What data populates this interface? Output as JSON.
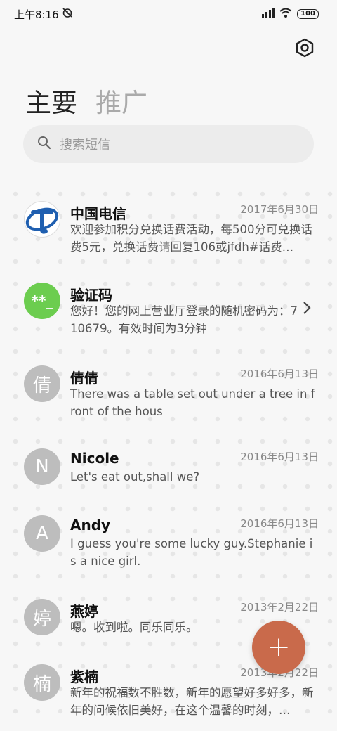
{
  "status_bar": {
    "time": "上午8:16",
    "battery": "100"
  },
  "tabs": [
    {
      "label": "主要"
    },
    {
      "label": "推广"
    }
  ],
  "search": {
    "placeholder": "搜索短信"
  },
  "messages": [
    {
      "name": "中国电信",
      "date": "2017年6月30日",
      "body": "欢迎参加积分兑换话费活动，每500分可兑换话费5元，兑换话费请回复106或jfdh#话费…",
      "avatar": "telecom-logo"
    },
    {
      "name": "验证码",
      "date": "",
      "body": "您好！您的网上营业厅登录的随机密码为：710679。有效时间为3分钟",
      "avatar_text": "**_"
    },
    {
      "name": "倩倩",
      "date": "2016年6月13日",
      "body": "There was a table set out under a tree in front of the hous",
      "avatar_text": "倩"
    },
    {
      "name": "Nicole",
      "date": "2016年6月13日",
      "body": "Let's eat out,shall we?",
      "avatar_text": "N"
    },
    {
      "name": "Andy",
      "date": "2016年6月13日",
      "body": "I guess you're some lucky guy.Stephanie is a nice girl.",
      "avatar_text": "A"
    },
    {
      "name": "燕婷",
      "date": "2013年2月22日",
      "body": "嗯。收到啦。同乐同乐。",
      "avatar_text": "婷"
    },
    {
      "name": "紫楠",
      "date": "2013年2月22日",
      "body": "新年的祝福数不胜数，新年的愿望好多好多，新年的问候依旧美好，在这个温馨的时刻，…",
      "avatar_text": "楠"
    }
  ],
  "colors": {
    "fab": "#c96a4b",
    "verification_avatar": "#6ccd4f",
    "avatar_default": "#bdbdbd"
  },
  "fab": {
    "label": "+"
  }
}
